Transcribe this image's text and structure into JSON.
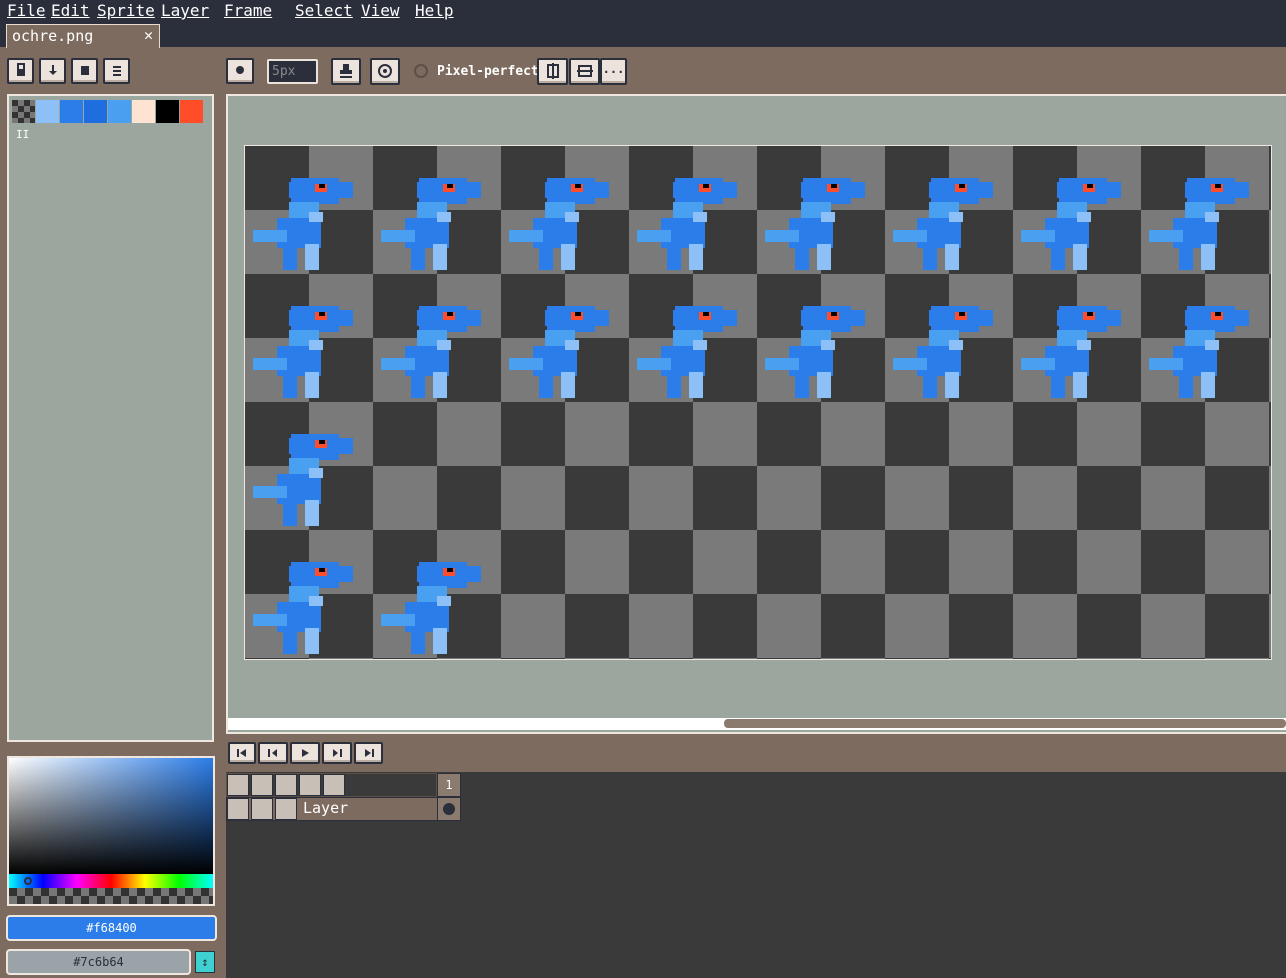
{
  "menu": [
    "File",
    "Edit",
    "Sprite",
    "Layer",
    "Frame",
    "Select",
    "View",
    "Help"
  ],
  "tab": {
    "label": "ochre.png",
    "close": "✕"
  },
  "toolbar": {
    "brush_size": "5px",
    "pixel_perfect_label": "Pixel-perfect",
    "more_label": "..."
  },
  "palette": {
    "swatches": [
      "checker",
      "#8cc0f6",
      "#2b7de9",
      "#1f6ee0",
      "#4aa0f0",
      "#ffe3d2",
      "#000000",
      "#ff4d2a"
    ],
    "cursor": "II"
  },
  "timeline": {
    "frame_number": "1",
    "layer_name": "Layer"
  },
  "colors": {
    "foreground_label": "#f68400",
    "background_label": "#7c6b64",
    "foreground": "#2b7de9",
    "background": "#9aa3a8",
    "swap_label": "↕"
  },
  "sprite": {
    "rows": [
      8,
      8,
      1,
      2
    ]
  }
}
